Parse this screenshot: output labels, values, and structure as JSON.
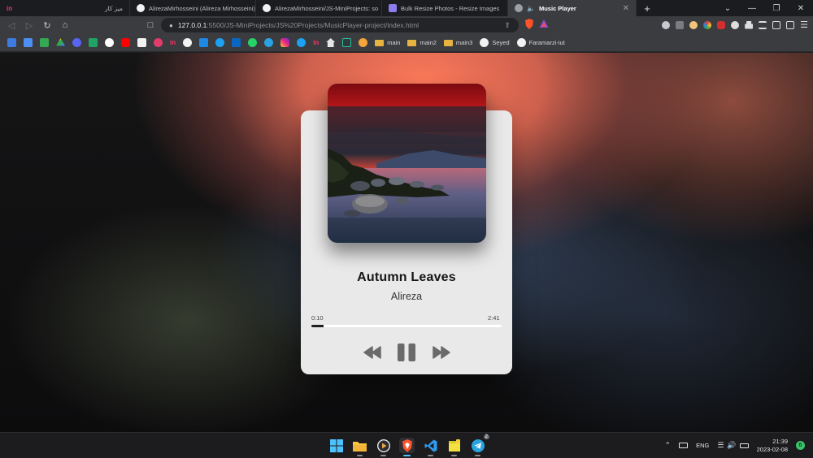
{
  "browser": {
    "tabs": [
      {
        "title": "میز کار",
        "favicon": "invision-icon"
      },
      {
        "title": "AlirezaMirhosseini (Alireza Mirhosseini)",
        "favicon": "github-icon"
      },
      {
        "title": "AlirezaMirhosseini/JS-MiniProjects: so",
        "favicon": "github-icon"
      },
      {
        "title": "Bulk Resize Photos - Resize Images",
        "favicon": "resize-icon"
      },
      {
        "title": "Music Player",
        "favicon": "globe-icon",
        "active": true
      }
    ],
    "new_tab": "+",
    "url": {
      "host": "127.0.0.1",
      "rest": ":5500/JS-MiniProjects/JS%20Projects/MusicPlayer-project/index.html"
    },
    "bookmarks": [
      {
        "label": "main",
        "type": "folder"
      },
      {
        "label": "main2",
        "type": "folder"
      },
      {
        "label": "main3",
        "type": "folder"
      },
      {
        "label": "Seyed",
        "type": "github"
      },
      {
        "label": "Faramarzi-iut",
        "type": "github"
      }
    ]
  },
  "player": {
    "title": "Autumn Leaves",
    "artist": "Alireza",
    "current_time": "0:10",
    "duration": "2:41",
    "progress_fraction": 0.062,
    "state": "playing",
    "cover_art": "sunset-lake-cover"
  },
  "taskbar": {
    "apps": [
      "windows-start-icon",
      "file-explorer-icon",
      "media-player-icon",
      "brave-browser-icon",
      "vscode-icon",
      "sticky-notes-icon",
      "telegram-icon"
    ],
    "telegram_badge": "2",
    "language": "ENG",
    "time": "21:39",
    "date": "2023-02-08",
    "notifications": "6"
  },
  "colors": {
    "background_glow": "#fd7a5a",
    "card": "#e9e9ea",
    "controls": "#6a6a6a",
    "accent_brave": "#fb542b"
  }
}
